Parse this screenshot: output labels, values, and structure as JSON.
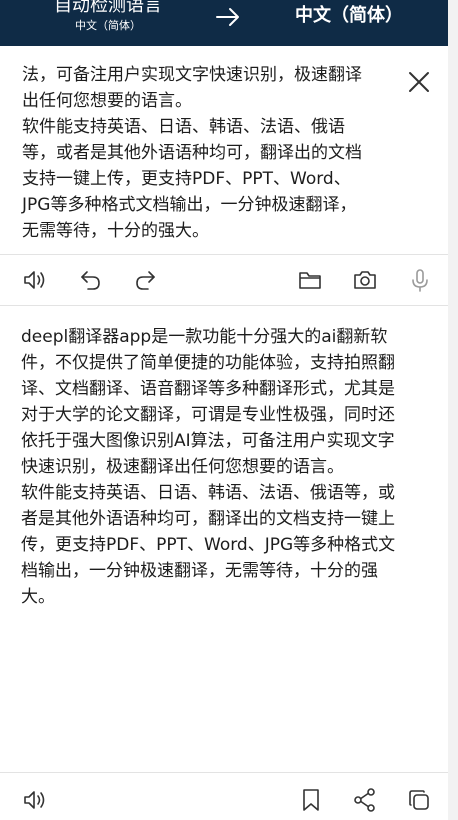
{
  "header": {
    "source_language": "自动检测语言",
    "source_detected": "中文（简体）",
    "swap_icon": "arrow-right-icon",
    "target_language": "中文（简体）"
  },
  "source": {
    "text": "法，可备注用户实现文字快速识别，极速翻译\n出任何您想要的语言。\n软件能支持英语、日语、韩语、法语、俄语\n等，或者是其他外语语种均可，翻译出的文档\n支持一键上传，更支持PDF、PPT、Word、\nJPG等多种格式文档输出，一分钟极速翻译，\n无需等待，十分的强大。",
    "close_icon": "close-icon"
  },
  "toolbar": {
    "icons": [
      "speaker-icon",
      "undo-icon",
      "redo-icon",
      "folder-icon",
      "camera-icon",
      "microphone-icon"
    ]
  },
  "translation": {
    "text": "deepl翻译器app是一款功能十分强大的ai翻新软\n件，不仅提供了简单便捷的功能体验，支持拍照翻\n译、文档翻译、语音翻译等多种翻译形式，尤其是\n对于大学的论文翻译，可谓是专业性极强，同时还\n依托于强大图像识别AI算法，可备注用户实现文字\n快速识别，极速翻译出任何您想要的语言。\n软件能支持英语、日语、韩语、法语、俄语等，或\n者是其他外语语种均可，翻译出的文档支持一键上\n传，更支持PDF、PPT、Word、JPG等多种格式文\n档输出，一分钟极速翻译，无需等待，十分的强\n大。"
  },
  "bottombar": {
    "icons": [
      "speaker-icon",
      "bookmark-icon",
      "share-icon",
      "copy-icon"
    ]
  },
  "colors": {
    "header_bg": "#0f2b46",
    "header_text": "#ffffff",
    "caret": "#1f5fa8",
    "icon": "#333333"
  }
}
